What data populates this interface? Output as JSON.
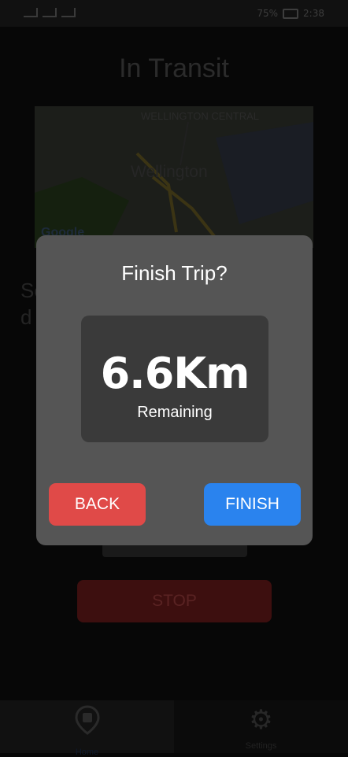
{
  "status_bar": {
    "battery": "75%",
    "time": "2:38"
  },
  "screen": {
    "title": "In Transit",
    "background_text": "Se                                    f\nd",
    "stop_label": "STOP"
  },
  "map": {
    "label_central": "WELLINGTON CENTRAL",
    "label_city": "Wellington",
    "attribution": "Google"
  },
  "dialog": {
    "title": "Finish Trip?",
    "distance_value": "6.6Km",
    "distance_label": "Remaining",
    "back_label": "BACK",
    "finish_label": "FINISH"
  },
  "bottom_nav": {
    "items": [
      {
        "label": "Home",
        "icon": "bus-location-pin-icon",
        "active": true
      },
      {
        "label": "Settings",
        "icon": "gear-icon",
        "active": false
      }
    ]
  },
  "colors": {
    "modal_bg": "#555555",
    "card_bg": "#3a3a3a",
    "back_button": "#e04a48",
    "finish_button": "#2a83ee"
  }
}
